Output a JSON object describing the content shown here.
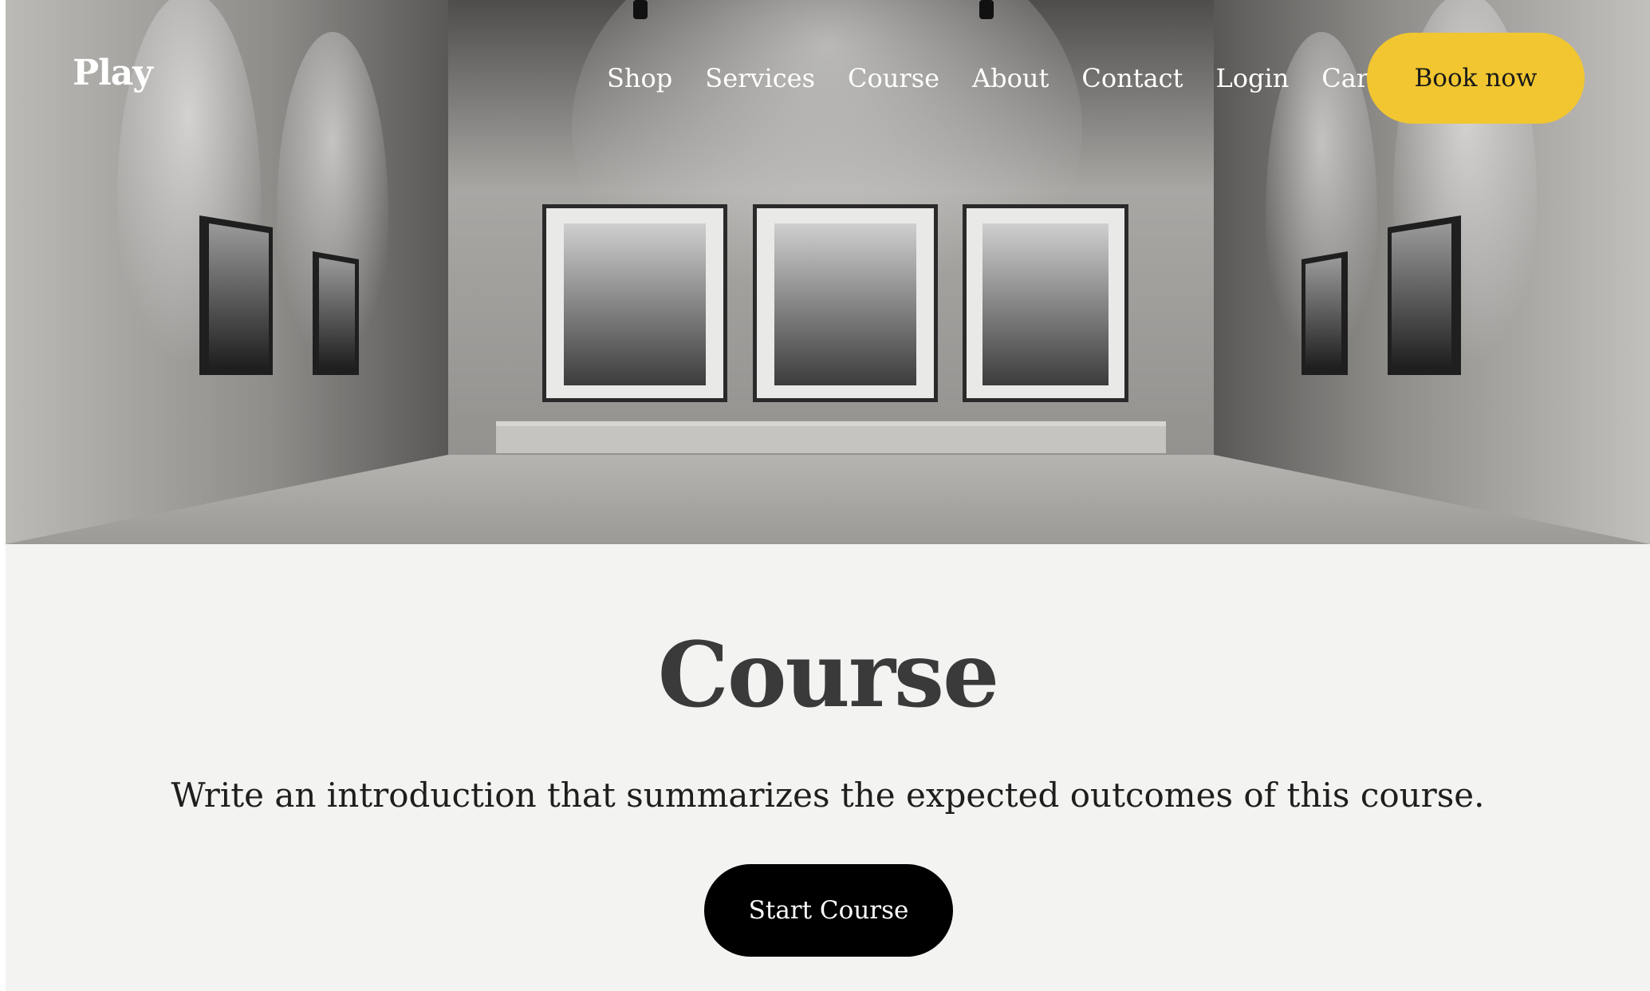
{
  "header": {
    "logo": "Play",
    "nav": [
      "Shop",
      "Services",
      "Course",
      "About",
      "Contact",
      "Login",
      "Cart"
    ],
    "book_label": "Book now"
  },
  "hero": {
    "image": "gallery-room-with-framed-photographs"
  },
  "main": {
    "title": "Course",
    "intro": "Write an introduction that summarizes the expected outcomes of this course.",
    "start_label": "Start Course"
  },
  "colors": {
    "accent": "#f1c630",
    "button_dark": "#000000",
    "background": "#f3f3f1",
    "heading": "#3a3a3a"
  }
}
